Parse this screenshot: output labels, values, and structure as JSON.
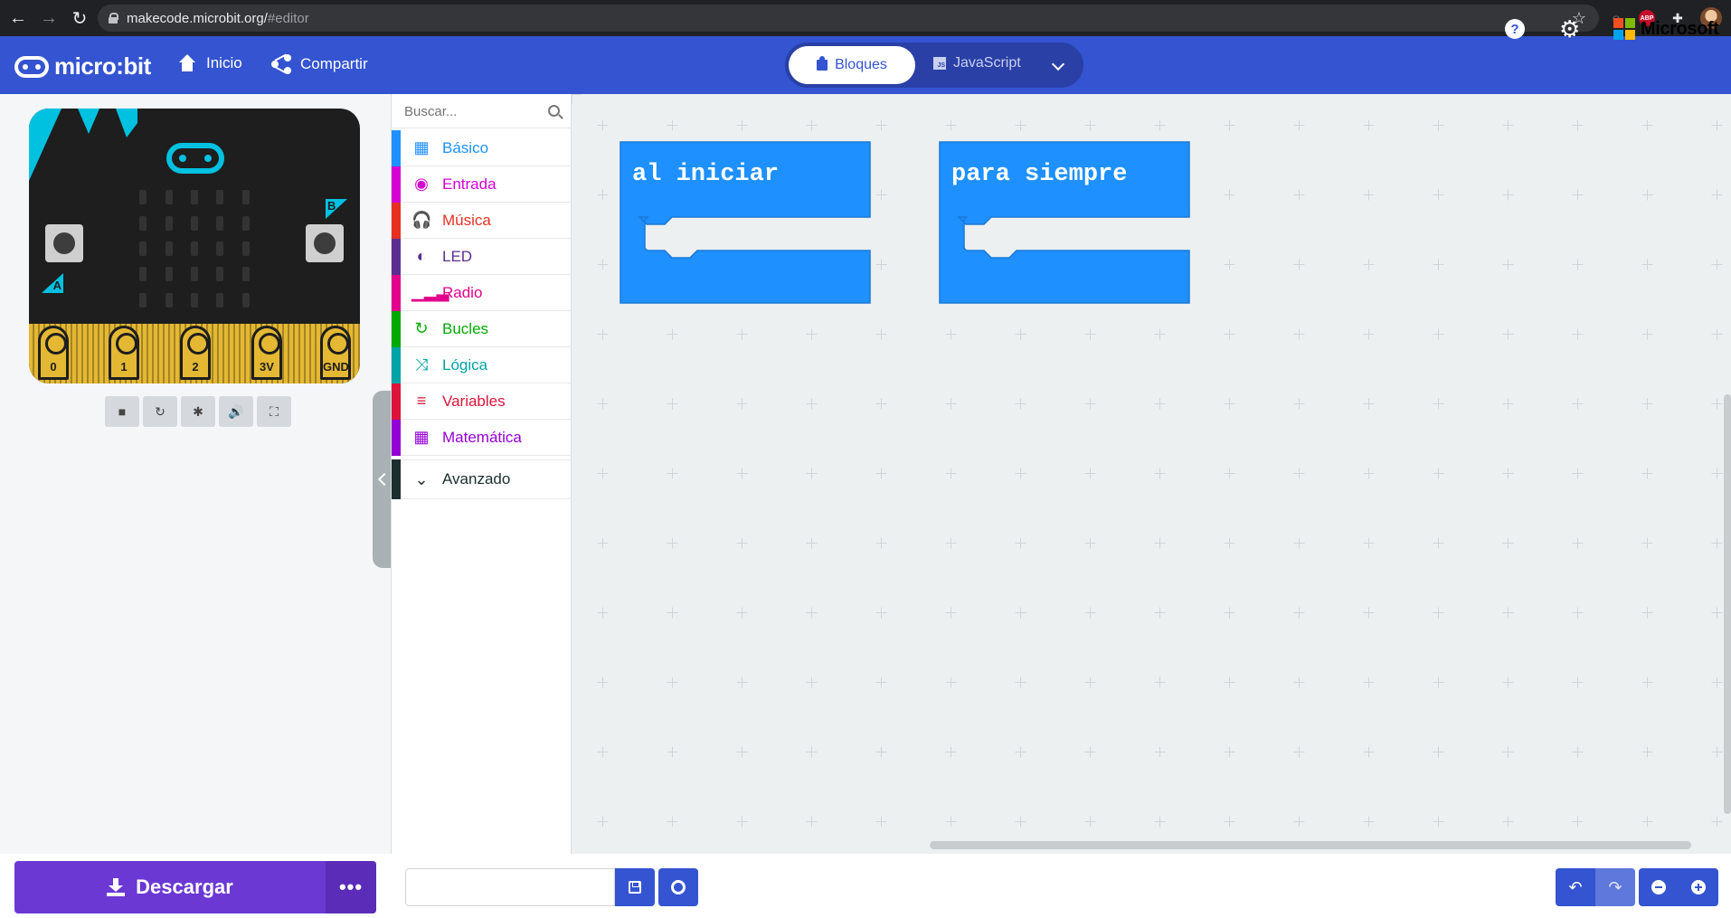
{
  "browser": {
    "url_host": "makecode.microbit.org/",
    "url_hash": "#editor",
    "extensions": [
      "pocket-icon",
      "adblock-icon",
      "puzzle-extensions-icon",
      "profile-avatar"
    ],
    "abp_label": "ABP"
  },
  "header": {
    "logo_text": "micro:bit",
    "home_label": "Inicio",
    "share_label": "Compartir",
    "mode_blocks_label": "Bloques",
    "mode_js_label": "JavaScript",
    "js_icon_text": "JS",
    "help_label": "?",
    "ms_label": "Microsoft",
    "accent": "#3454d1"
  },
  "simulator": {
    "pins": [
      "0",
      "1",
      "2",
      "3V",
      "GND"
    ],
    "button_a": "A",
    "button_b": "B",
    "controls": [
      {
        "name": "stop-icon",
        "glyph": "■"
      },
      {
        "name": "restart-icon",
        "glyph": "↻"
      },
      {
        "name": "debug-icon",
        "glyph": "✱"
      },
      {
        "name": "sound-icon",
        "glyph": "🔊"
      },
      {
        "name": "fullscreen-icon",
        "glyph": "⛶"
      }
    ]
  },
  "toolbox": {
    "search_placeholder": "Buscar...",
    "categories": [
      {
        "label": "Básico",
        "color": "#1e90ff",
        "icon": "▦",
        "icon_name": "grid-icon"
      },
      {
        "label": "Entrada",
        "color": "#d400d4",
        "icon": "◉",
        "icon_name": "target-icon"
      },
      {
        "label": "Música",
        "color": "#e63022",
        "icon": "🎧",
        "icon_name": "headphones-icon"
      },
      {
        "label": "LED",
        "color": "#5c2d91",
        "icon": "◐",
        "icon_name": "toggle-icon"
      },
      {
        "label": "Radio",
        "color": "#e3008c",
        "icon": "▁▂▃",
        "icon_name": "signal-icon"
      },
      {
        "label": "Bucles",
        "color": "#00aa00",
        "icon": "↻",
        "icon_name": "loop-icon"
      },
      {
        "label": "Lógica",
        "color": "#00a4a6",
        "icon": "⤨",
        "icon_name": "shuffle-icon"
      },
      {
        "label": "Variables",
        "color": "#dc143c",
        "icon": "≡",
        "icon_name": "list-icon"
      },
      {
        "label": "Matemática",
        "color": "#9400d3",
        "icon": "▦",
        "icon_name": "calculator-icon"
      }
    ],
    "advanced": {
      "label": "Avanzado",
      "color": "#1c2e2d",
      "icon": "⌄",
      "icon_name": "chevron-down-icon"
    }
  },
  "workspace": {
    "blocks": [
      {
        "label": "al iniciar",
        "color": "#1e90ff"
      },
      {
        "label": "para siempre",
        "color": "#1e90ff"
      }
    ]
  },
  "bottom": {
    "download_label": "Descargar",
    "more_label": "•••",
    "project_name": "",
    "undo_glyph": "↶",
    "redo_glyph": "↷"
  }
}
